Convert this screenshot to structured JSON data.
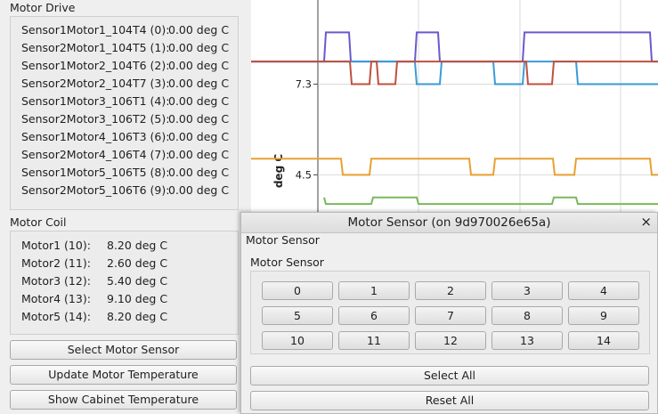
{
  "motor_drive": {
    "title": "Motor Drive",
    "rows": [
      {
        "label": "Sensor1Motor1_104T4 (0):",
        "value": "0.00 deg C"
      },
      {
        "label": "Sensor2Motor1_104T5 (1):",
        "value": "0.00 deg C"
      },
      {
        "label": "Sensor1Motor2_104T6 (2):",
        "value": "0.00 deg C"
      },
      {
        "label": "Sensor2Motor2_104T7 (3):",
        "value": "0.00 deg C"
      },
      {
        "label": "Sensor1Motor3_106T1 (4):",
        "value": "0.00 deg C"
      },
      {
        "label": "Sensor2Motor3_106T2 (5):",
        "value": "0.00 deg C"
      },
      {
        "label": "Sensor1Motor4_106T3 (6):",
        "value": "0.00 deg C"
      },
      {
        "label": "Sensor2Motor4_106T4 (7):",
        "value": "0.00 deg C"
      },
      {
        "label": "Sensor1Motor5_106T5 (8):",
        "value": "0.00 deg C"
      },
      {
        "label": "Sensor2Motor5_106T6 (9):",
        "value": "0.00 deg C"
      }
    ]
  },
  "motor_coil": {
    "title": "Motor Coil",
    "rows": [
      {
        "label": "Motor1 (10):",
        "value": "8.20 deg C"
      },
      {
        "label": "Motor2 (11):",
        "value": "2.60 deg C"
      },
      {
        "label": "Motor3 (12):",
        "value": "5.40 deg C"
      },
      {
        "label": "Motor4 (13):",
        "value": "9.10 deg C"
      },
      {
        "label": "Motor5 (14):",
        "value": "8.20 deg C"
      }
    ]
  },
  "buttons": {
    "select_motor_sensor": "Select Motor Sensor",
    "update_motor_temperature": "Update Motor Temperature",
    "show_cabinet_temperature": "Show Cabinet Temperature"
  },
  "chart_data": {
    "type": "line",
    "ylabel": "deg C",
    "y_ticks": [
      "7.3",
      "4.5"
    ],
    "y_tick_values": [
      7.3,
      4.5
    ],
    "ylim": [
      3.3,
      9.9
    ],
    "x_range": [
      0,
      457
    ],
    "grid": true,
    "series": [
      {
        "color": "#6a5acd",
        "points": [
          [
            0,
            8.0
          ],
          [
            82,
            8.0
          ],
          [
            84,
            8.9
          ],
          [
            110,
            8.9
          ],
          [
            112,
            8.0
          ],
          [
            184,
            8.0
          ],
          [
            186,
            8.9
          ],
          [
            210,
            8.9
          ],
          [
            212,
            8.0
          ],
          [
            305,
            8.0
          ],
          [
            307,
            8.9
          ],
          [
            448,
            8.9
          ],
          [
            450,
            8.0
          ],
          [
            457,
            8.0
          ]
        ]
      },
      {
        "color": "#3a9ad9",
        "points": [
          [
            0,
            8.0
          ],
          [
            184,
            8.0
          ],
          [
            186,
            7.3
          ],
          [
            212,
            7.3
          ],
          [
            214,
            8.0
          ],
          [
            272,
            8.0
          ],
          [
            274,
            7.3
          ],
          [
            305,
            7.3
          ],
          [
            307,
            8.0
          ],
          [
            365,
            8.0
          ],
          [
            367,
            7.3
          ],
          [
            457,
            7.3
          ]
        ]
      },
      {
        "color": "#c0503d",
        "points": [
          [
            0,
            8.0
          ],
          [
            111,
            8.0
          ],
          [
            113,
            7.3
          ],
          [
            133,
            7.3
          ],
          [
            135,
            8.0
          ],
          [
            141,
            8.0
          ],
          [
            143,
            7.3
          ],
          [
            162,
            7.3
          ],
          [
            164,
            8.0
          ],
          [
            309,
            8.0
          ],
          [
            311,
            7.3
          ],
          [
            338,
            7.3
          ],
          [
            340,
            8.0
          ],
          [
            457,
            8.0
          ]
        ]
      },
      {
        "color": "#e8a030",
        "points": [
          [
            0,
            5.0
          ],
          [
            101,
            5.0
          ],
          [
            103,
            4.5
          ],
          [
            133,
            4.5
          ],
          [
            135,
            5.0
          ],
          [
            245,
            5.0
          ],
          [
            247,
            4.5
          ],
          [
            272,
            4.5
          ],
          [
            274,
            5.0
          ],
          [
            339,
            5.0
          ],
          [
            341,
            4.5
          ],
          [
            363,
            4.5
          ],
          [
            365,
            5.0
          ],
          [
            448,
            5.0
          ],
          [
            450,
            4.5
          ],
          [
            457,
            4.5
          ]
        ]
      },
      {
        "color": "#7ab85a",
        "points": [
          [
            82,
            3.8
          ],
          [
            84,
            3.6
          ],
          [
            135,
            3.6
          ],
          [
            137,
            3.8
          ],
          [
            186,
            3.8
          ],
          [
            188,
            3.6
          ],
          [
            338,
            3.6
          ],
          [
            340,
            3.8
          ],
          [
            365,
            3.8
          ],
          [
            367,
            3.6
          ],
          [
            457,
            3.6
          ]
        ]
      }
    ]
  },
  "dialog": {
    "title": "Motor Sensor (on 9d970026e65a)",
    "close_glyph": "×",
    "header_label": "Motor Sensor",
    "group_label": "Motor Sensor",
    "sensor_buttons": [
      "0",
      "1",
      "2",
      "3",
      "4",
      "5",
      "6",
      "7",
      "8",
      "9",
      "10",
      "11",
      "12",
      "13",
      "14"
    ],
    "select_all": "Select All",
    "reset_all": "Reset All"
  }
}
